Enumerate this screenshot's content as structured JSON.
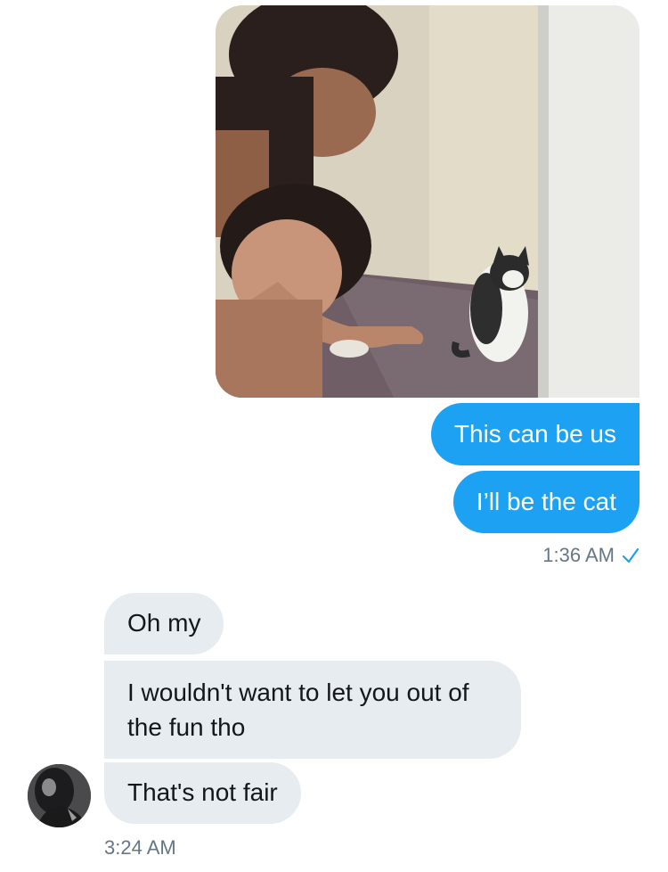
{
  "conversation": {
    "outgoing": {
      "image": {
        "kind": "photo",
        "alt_subject": "two women and a cat"
      },
      "messages": [
        "This can be us",
        "I’ll be the cat"
      ],
      "timestamp": "1:36 AM",
      "status_icon": "checkmark-icon"
    },
    "incoming": {
      "messages": [
        "Oh my",
        "I wouldn't want to let you out of the fun tho",
        "That's not fair"
      ],
      "timestamp": "3:24 AM",
      "avatar_icon": "avatar"
    }
  },
  "colors": {
    "outgoing_bubble": "#1da1f2",
    "incoming_bubble": "#e6ecf0",
    "incoming_text": "#14171a",
    "meta_text": "#657786",
    "check": "#1da1f2"
  }
}
